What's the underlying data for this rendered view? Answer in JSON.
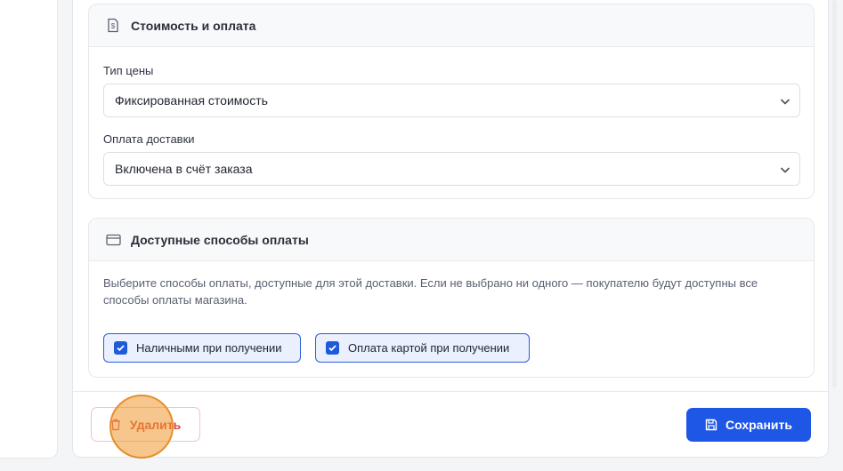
{
  "pricing_card": {
    "title": "Стоимость и оплата",
    "icon": "receipt-dollar-icon",
    "price_type": {
      "label": "Тип цены",
      "value": "Фиксированная стоимость"
    },
    "delivery_payment": {
      "label": "Оплата доставки",
      "value": "Включена в счёт заказа"
    }
  },
  "payment_methods_card": {
    "title": "Доступные способы оплаты",
    "icon": "credit-card-icon",
    "description": "Выберите способы оплаты, доступные для этой доставки. Если не выбрано ни одного — покупателю будут доступны все способы оплаты магазина.",
    "options": [
      {
        "label": "Наличными при получении",
        "checked": true
      },
      {
        "label": "Оплата картой при получении",
        "checked": true
      }
    ]
  },
  "footer": {
    "delete_label": "Удалить",
    "save_label": "Сохранить"
  },
  "colors": {
    "primary": "#1e56e6",
    "danger": "#d94a3a",
    "click_indicator": "#f09830"
  }
}
